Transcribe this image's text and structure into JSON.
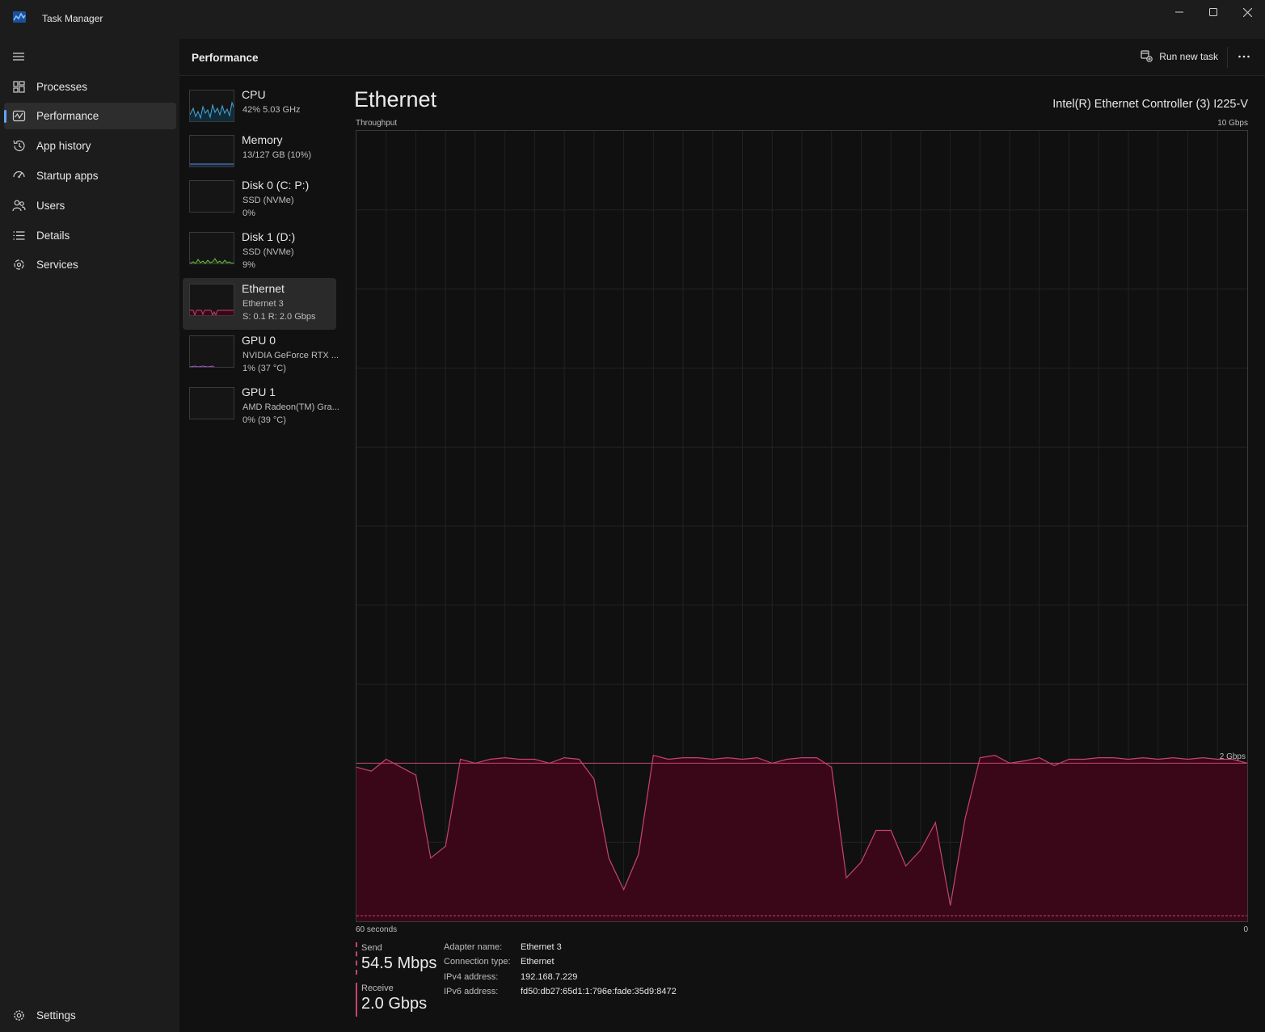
{
  "window": {
    "title": "Task Manager"
  },
  "nav": {
    "items": [
      {
        "label": "Processes",
        "icon": "processes-icon"
      },
      {
        "label": "Performance",
        "icon": "performance-icon",
        "active": true
      },
      {
        "label": "App history",
        "icon": "history-icon"
      },
      {
        "label": "Startup apps",
        "icon": "startup-icon"
      },
      {
        "label": "Users",
        "icon": "users-icon"
      },
      {
        "label": "Details",
        "icon": "details-icon"
      },
      {
        "label": "Services",
        "icon": "services-icon"
      }
    ],
    "settings_label": "Settings"
  },
  "header": {
    "title": "Performance",
    "run_new_task": "Run new task"
  },
  "devices": [
    {
      "name": "CPU",
      "sub1": "42%  5.03 GHz",
      "sub2": "",
      "color": "#4aa8d8"
    },
    {
      "name": "Memory",
      "sub1": "13/127 GB (10%)",
      "sub2": "",
      "color": "#5b8cd6"
    },
    {
      "name": "Disk 0 (C: P:)",
      "sub1": "SSD (NVMe)",
      "sub2": "0%",
      "color": "#6dbf3f"
    },
    {
      "name": "Disk 1 (D:)",
      "sub1": "SSD (NVMe)",
      "sub2": "9%",
      "color": "#6dbf3f"
    },
    {
      "name": "Ethernet",
      "sub1": "Ethernet 3",
      "sub2": "S: 0.1  R: 2.0 Gbps",
      "color": "#c44475",
      "active": true
    },
    {
      "name": "GPU 0",
      "sub1": "NVIDIA GeForce RTX ...",
      "sub2": "1%  (37 °C)",
      "color": "#a855d8"
    },
    {
      "name": "GPU 1",
      "sub1": "AMD Radeon(TM) Gra...",
      "sub2": "0%  (39 °C)",
      "color": "#a855d8"
    }
  ],
  "main": {
    "title": "Ethernet",
    "adapter_model": "Intel(R) Ethernet Controller (3) I225-V",
    "graph_label": "Throughput",
    "graph_max": "10 Gbps",
    "graph_ref": "2 Gbps",
    "time_left": "60 seconds",
    "time_right": "0",
    "send_label": "Send",
    "send_value": "54.5 Mbps",
    "receive_label": "Receive",
    "receive_value": "2.0 Gbps",
    "properties": [
      {
        "key": "Adapter name:",
        "value": "Ethernet 3"
      },
      {
        "key": "Connection type:",
        "value": "Ethernet"
      },
      {
        "key": "IPv4 address:",
        "value": "192.168.7.229"
      },
      {
        "key": "IPv6 address:",
        "value": "fd50:db27:65d1:1:796e:fade:35d9:8472"
      }
    ]
  },
  "chart_data": {
    "type": "area",
    "x_label": "60 seconds",
    "ylim": [
      0,
      10
    ],
    "y_unit": "Gbps",
    "reference_line": 2,
    "colors": {
      "line": "#c44475",
      "fill": "#3a0718",
      "grid": "#222222"
    },
    "series": [
      {
        "name": "Receive",
        "x": [
          0,
          1,
          2,
          3,
          4,
          5,
          6,
          7,
          8,
          9,
          10,
          11,
          12,
          13,
          14,
          15,
          16,
          17,
          18,
          19,
          20,
          21,
          22,
          23,
          24,
          25,
          26,
          27,
          28,
          29,
          30,
          31,
          32,
          33,
          34,
          35,
          36,
          37,
          38,
          39,
          40,
          41,
          42,
          43,
          44,
          45,
          46,
          47,
          48,
          49,
          50,
          51,
          52,
          53,
          54,
          55,
          56,
          57,
          58,
          59,
          60
        ],
        "values": [
          1.95,
          1.9,
          2.05,
          1.95,
          1.85,
          0.8,
          0.95,
          2.05,
          2.0,
          2.05,
          2.07,
          2.05,
          2.05,
          2.0,
          2.07,
          2.05,
          1.8,
          0.8,
          0.4,
          0.85,
          2.1,
          2.05,
          2.07,
          2.07,
          2.05,
          2.07,
          2.05,
          2.07,
          2.0,
          2.05,
          2.07,
          2.07,
          1.95,
          0.55,
          0.75,
          1.15,
          1.15,
          0.7,
          0.9,
          1.25,
          0.2,
          1.3,
          2.07,
          2.1,
          2.0,
          2.03,
          2.07,
          1.97,
          2.05,
          2.05,
          2.07,
          2.07,
          2.05,
          2.07,
          2.05,
          2.07,
          2.05,
          2.07,
          2.05,
          2.05,
          2.0
        ]
      },
      {
        "name": "Send",
        "x": [
          0,
          60
        ],
        "values": [
          0.05,
          0.05
        ]
      }
    ]
  }
}
